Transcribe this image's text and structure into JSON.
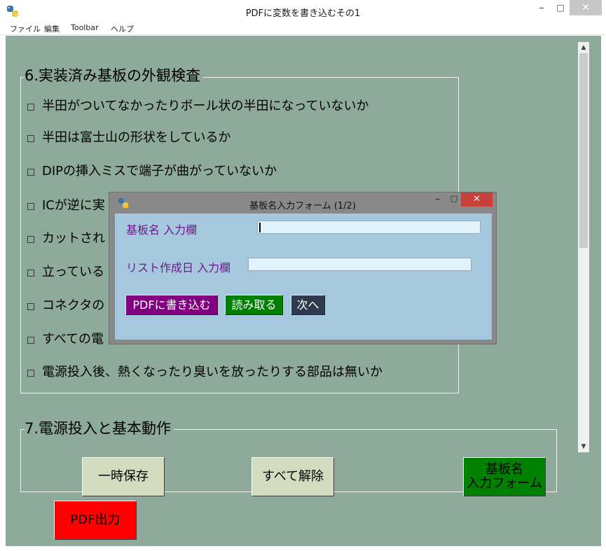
{
  "window": {
    "title": "PDFに変数を書き込むその1",
    "minimize_glyph": "‒",
    "maximize_glyph": "□",
    "close_glyph": "✕"
  },
  "menu": [
    "ファイル",
    "編集",
    "Toolbar",
    "ヘルプ"
  ],
  "section6": {
    "title": "6.実装済み基板の外観検査",
    "items": [
      "半田がついてなかったりボール状の半田になっていないか",
      "半田は富士山の形状をしているか",
      "DIPの挿入ミスで端子が曲がっていないか",
      "ICが逆に実",
      "カットされ",
      "立っている",
      "コネクタの",
      "すべての電",
      "電源投入後、熱くなったり臭いを放ったりする部品は無いか"
    ]
  },
  "section7": {
    "title": "7.電源投入と基本動作"
  },
  "scrollbar": {
    "up_glyph": "▲",
    "down_glyph": "▼"
  },
  "buttons": {
    "temp_save": "一時保存",
    "clear_all": "すべて解除",
    "board_form_line1": "基板名",
    "board_form_line2": "入力フォーム",
    "pdf_output": "PDF出力"
  },
  "dialog": {
    "title": "基板名入力フォーム (1/2)",
    "minimize_glyph": "‒",
    "maximize_glyph": "□",
    "close_glyph": "✕",
    "board_name_label": "基板名  入力欄",
    "board_name_value": "",
    "list_date_label": "リスト作成日  入力欄",
    "list_date_value": "",
    "write_pdf_button": "PDFに書き込む",
    "read_button": "読み取る",
    "next_button": "次へ"
  },
  "colors": {
    "canvas": "#8eaa9a",
    "dialog_body": "#a6c8df",
    "dialog_label": "#6a1d86",
    "write_pdf_button": "#800080",
    "read_button": "#008000",
    "next_button": "#2e3b4e",
    "board_form_button": "#008000",
    "pdf_output_button": "#ff0000",
    "light_button": "#d4dcc0"
  }
}
